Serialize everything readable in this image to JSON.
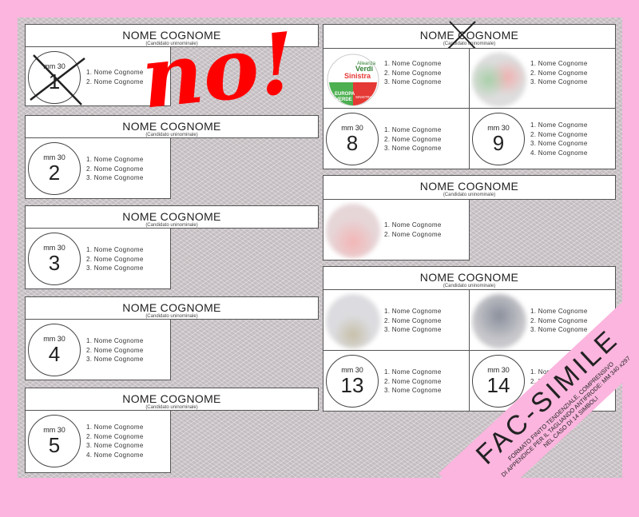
{
  "header_name": "NOME COGNOME",
  "header_sub": "(Candidato uninominale)",
  "mm_label": "mm 30",
  "list_names": [
    "1.  Nome Cognome",
    "2.  Nome Cognome",
    "3.  Nome Cognome",
    "4.  Nome Cognome"
  ],
  "symbols": {
    "s1": "1",
    "s2": "2",
    "s3": "3",
    "s4": "4",
    "s5": "5",
    "s8": "8",
    "s9": "9",
    "s13": "13",
    "s14": "14"
  },
  "logo": {
    "text": "Alleanza Verdi Sinistra",
    "left": "EUROPA VERDE",
    "right": "SINISTRA ITALIANA",
    "colors": {
      "green": "#4caf50",
      "red": "#e53935"
    }
  },
  "overlay": {
    "text": "no!",
    "color": "#ff0000"
  },
  "banner": {
    "title": "FAC-SIMILE",
    "line1": "FORMATO FINITO TENDENZIALE, COMPRENSIVO",
    "line2": "DI APPENDICE PER IL TAGLIANDO ANTIFRODE: MM 340 x297",
    "line3": "NEL CASO DI 14 SIMBOLI",
    "color": "#fbb5de"
  }
}
